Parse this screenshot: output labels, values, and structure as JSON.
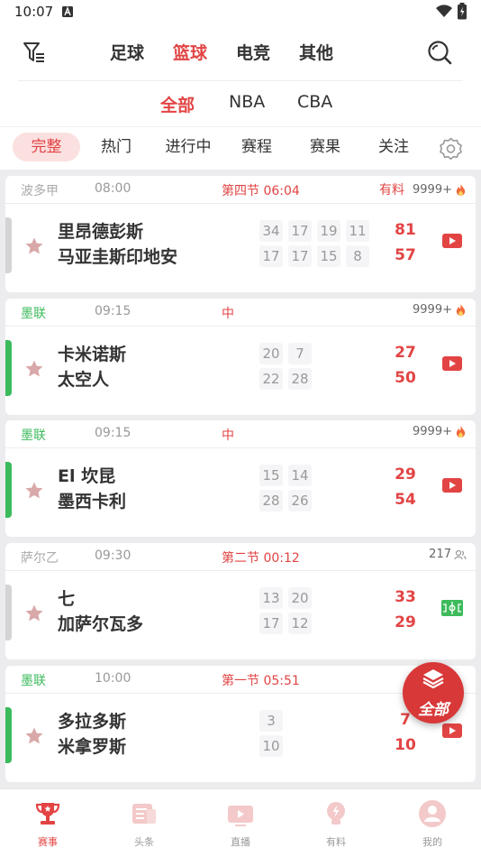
{
  "status_bar": {
    "time": "10:07"
  },
  "sport_tabs": {
    "items": [
      "足球",
      "篮球",
      "电竞",
      "其他"
    ],
    "active": "篮球"
  },
  "league_tabs": {
    "items": [
      "全部",
      "NBA",
      "CBA"
    ],
    "active": "全部"
  },
  "filter_tabs": {
    "items": [
      "完整",
      "热门",
      "进行中",
      "赛程",
      "赛果",
      "关注"
    ],
    "active": "完整"
  },
  "matches": [
    {
      "league": "波多甲",
      "time": "08:00",
      "status": "第四节 06:04",
      "tip": "有料",
      "heat": "9999+",
      "home": "里昂德彭斯",
      "away": "马亚圭斯印地安",
      "home_quarters": [
        "34",
        "17",
        "19",
        "11"
      ],
      "away_quarters": [
        "17",
        "17",
        "15",
        "8"
      ],
      "home_score": "81",
      "away_score": "57",
      "media": "video",
      "accent": "#d4d4d4"
    },
    {
      "league": "墨联",
      "time": "09:15",
      "status": "中",
      "tip": "",
      "heat": "9999+",
      "home": "卡米诺斯",
      "away": "太空人",
      "home_quarters": [
        "20",
        "7"
      ],
      "away_quarters": [
        "22",
        "28"
      ],
      "home_score": "27",
      "away_score": "50",
      "media": "video",
      "accent": "#3dbb5c"
    },
    {
      "league": "墨联",
      "time": "09:15",
      "status": "中",
      "tip": "",
      "heat": "9999+",
      "home": "El 坎昆",
      "away": "墨西卡利",
      "home_quarters": [
        "15",
        "14"
      ],
      "away_quarters": [
        "28",
        "26"
      ],
      "home_score": "29",
      "away_score": "54",
      "media": "video",
      "accent": "#3dbb5c"
    },
    {
      "league": "萨尔乙",
      "time": "09:30",
      "status": "第二节 00:12",
      "tip": "",
      "heat": "217",
      "home": "七",
      "away": "加萨尔瓦多",
      "home_quarters": [
        "13",
        "20"
      ],
      "away_quarters": [
        "17",
        "12"
      ],
      "home_score": "33",
      "away_score": "29",
      "media": "animation",
      "accent": "#d4d4d4"
    },
    {
      "league": "墨联",
      "time": "10:00",
      "status": "第一节 05:51",
      "tip": "",
      "heat": "",
      "home": "多拉多斯",
      "away": "米拿罗斯",
      "home_quarters": [
        "3"
      ],
      "away_quarters": [
        "10"
      ],
      "home_score": "7",
      "away_score": "10",
      "media": "video",
      "accent": "#3dbb5c"
    }
  ],
  "float_button": {
    "label": "全部"
  },
  "bottom_nav": {
    "items": [
      "赛事",
      "头条",
      "直播",
      "有料",
      "我的"
    ],
    "active": "赛事"
  },
  "colors": {
    "accent": "#e24444",
    "live_green": "#3dbb5c",
    "muted": "#999999"
  }
}
